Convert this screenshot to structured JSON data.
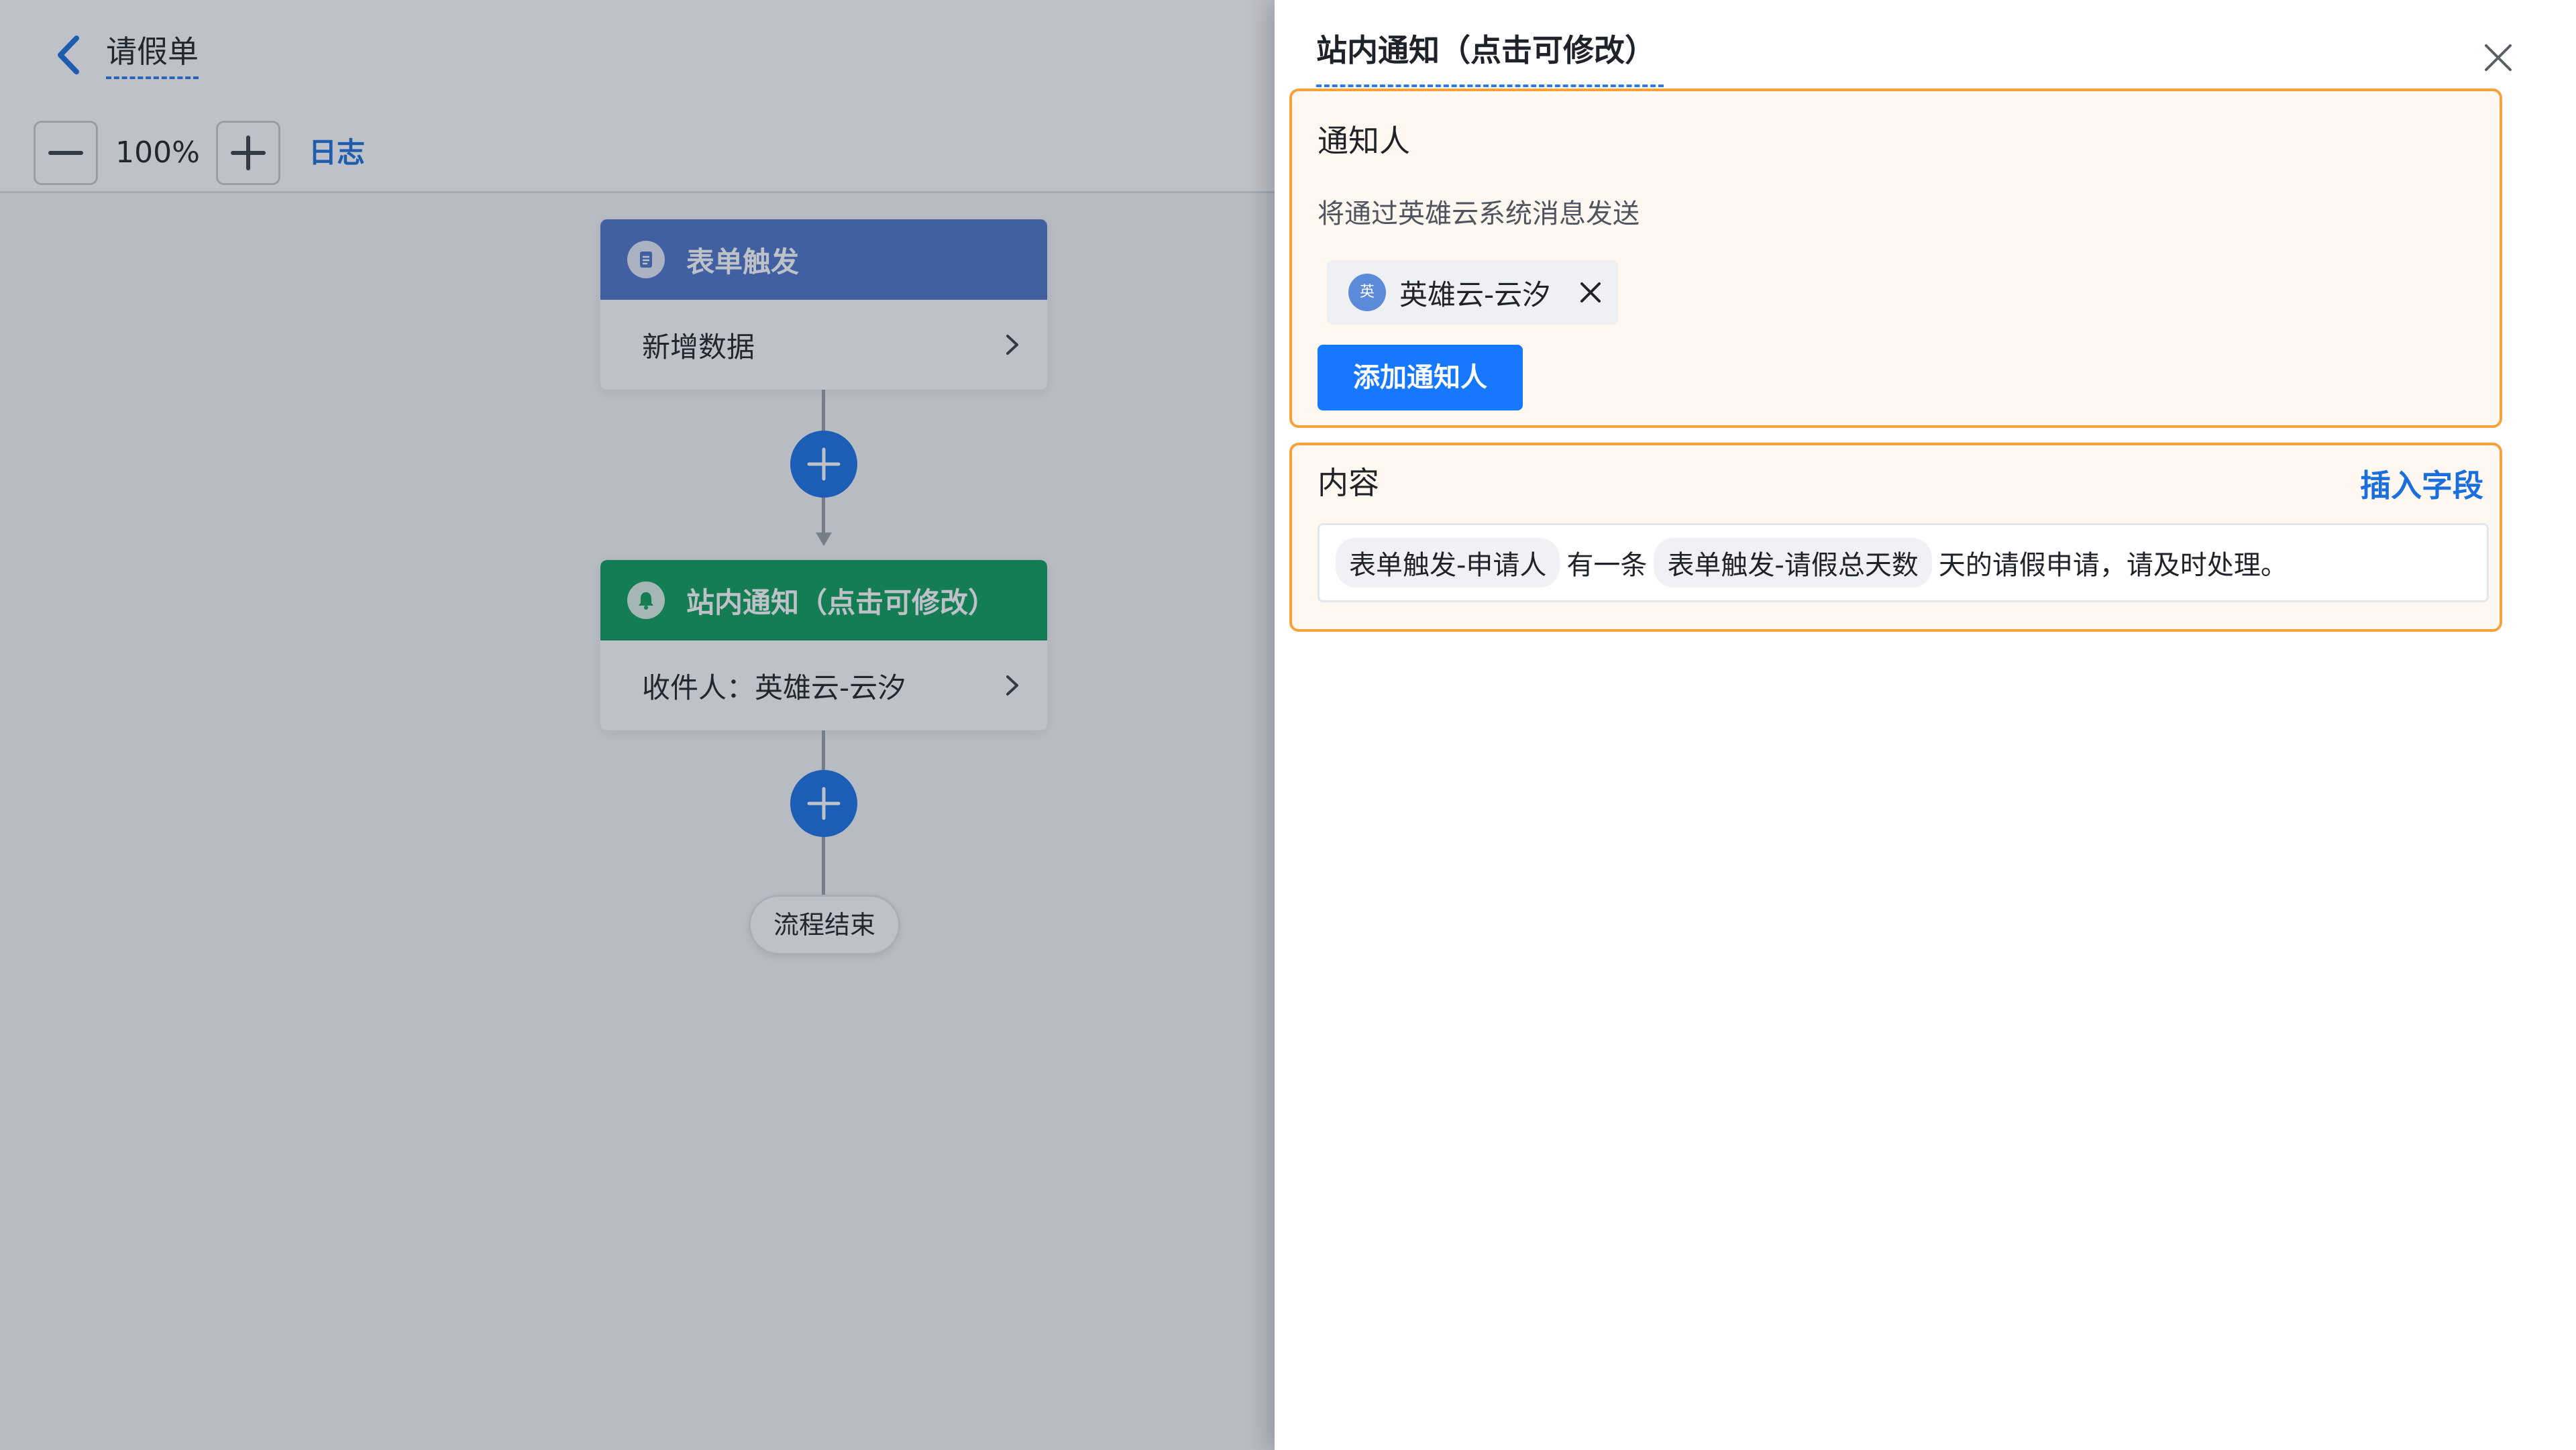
{
  "header": {
    "title": "请假单"
  },
  "toolbar": {
    "zoom_level": "100%",
    "log_label": "日志"
  },
  "flow": {
    "trigger": {
      "title": "表单触发",
      "body": "新增数据"
    },
    "notify": {
      "title": "站内通知（点击可修改）",
      "body": "收件人：英雄云-云汐"
    },
    "end_label": "流程结束"
  },
  "drawer": {
    "title": "站内通知（点击可修改）",
    "recipients": {
      "title": "通知人",
      "description": "将通过英雄云系统消息发送",
      "tag": {
        "avatar_text": "英",
        "name": "英雄云-云汐"
      },
      "add_button": "添加通知人"
    },
    "content": {
      "title": "内容",
      "insert_field": "插入字段",
      "message": {
        "chip1": "表单触发-申请人",
        "text1": "有一条",
        "chip2": "表单触发-请假总天数",
        "text2": "天的请假申请，请及时处理。"
      }
    }
  },
  "colors": {
    "trigger_header": "#4c74c9",
    "notify_header": "#0c9e5a",
    "accent_blue": "#1677ff",
    "panel_border": "#f7a13b"
  }
}
